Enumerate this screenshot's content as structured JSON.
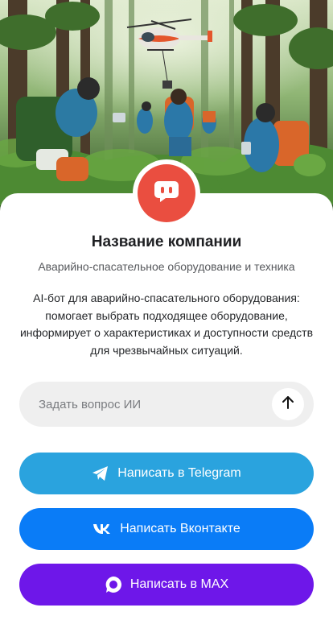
{
  "company": {
    "name": "Название компании",
    "subtitle": "Аварийно-спасательное оборудование и техника",
    "description": "AI-бот для аварийно-спасательного оборудования: помогает выбрать подходящее оборудование, информирует о характеристиках и доступности средств для чрезвычайных ситуаций."
  },
  "ask": {
    "placeholder": "Задать вопрос ИИ",
    "send_icon": "arrow-up-icon"
  },
  "buttons": {
    "telegram": {
      "label": "Написать в Telegram",
      "icon": "telegram-icon",
      "color": "#2aa3de"
    },
    "vk": {
      "label": "Написать Вконтакте",
      "icon": "vk-icon",
      "color": "#0a7cf7"
    },
    "max": {
      "label": "Написать в MAX",
      "icon": "max-icon",
      "color": "#6e17e9"
    }
  },
  "logo": {
    "icon": "chat-bot-icon",
    "color": "#ea4e40"
  },
  "hero": {
    "alt": "rescue-team-in-forest-illustration"
  }
}
